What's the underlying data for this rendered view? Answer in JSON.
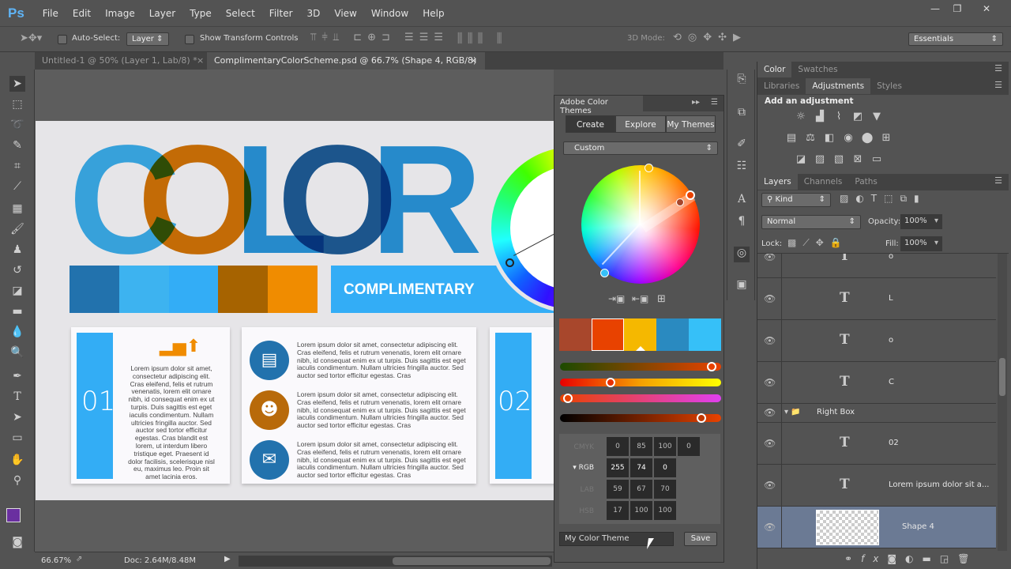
{
  "app": {
    "logo": "Ps",
    "menu": [
      "File",
      "Edit",
      "Image",
      "Layer",
      "Type",
      "Select",
      "Filter",
      "3D",
      "View",
      "Window",
      "Help"
    ],
    "window_controls": [
      "—",
      "❐",
      "✕"
    ]
  },
  "options": {
    "auto_select": "Auto-Select:",
    "layer_select": "Layer",
    "show_transform": "Show Transform Controls",
    "mode_3d": "3D Mode:",
    "workspace": "Essentials"
  },
  "tabs": [
    {
      "label": "Untitled-1 @ 50% (Layer 1, Lab/8) *",
      "close": "×"
    },
    {
      "label": "ComplimentaryColorScheme.psd @ 66.7% (Shape 4, RGB/8)",
      "close": "×"
    }
  ],
  "canvas": {
    "letters": [
      "C",
      "O",
      "L",
      "O",
      "R"
    ],
    "swatches": [
      "#2272ad",
      "#3db3f0",
      "#33adf6",
      "#a66300",
      "#f08c00"
    ],
    "banner": "COMPLIMENTARY",
    "card1": {
      "number": "01",
      "text": "Lorem ipsum dolor sit amet, consectetur adipiscing elit. Cras eleifend, felis et rutrum venenatis, lorem elit ornare nibh, id consequat enim ex ut turpis. Duis sagittis est eget iaculis condimentum. Nullam ultricies fringilla auctor. Sed auctor sed tortor efficitur egestas. Cras blandit est lorem, ut interdum libero tristique eget. Praesent id dolor facilisis, scelerisque nisl eu, maximus leo. Proin sit amet lacinia eros."
    },
    "card2": {
      "items": [
        {
          "icon": "browser-window-icon",
          "color": "#2272ad",
          "text": "Lorem ipsum dolor sit amet, consectetur adipiscing elit. Cras eleifend, felis et rutrum venenatis, lorem elit ornare nibh, id consequat enim ex ut turpis. Duis sagittis est eget iaculis condimentum. Nullam ultricies fringilla auctor. Sed auctor sed tortor efficitur egestas. Cras"
        },
        {
          "icon": "user-star-icon",
          "color": "#b86a0a",
          "text": "Lorem ipsum dolor sit amet, consectetur adipiscing elit. Cras eleifend, felis et rutrum venenatis, lorem elit ornare nibh, id consequat enim ex ut turpis. Duis sagittis est eget iaculis condimentum. Nullam ultricies fringilla auctor. Sed auctor sed tortor efficitur egestas. Cras"
        },
        {
          "icon": "envelope-icon",
          "color": "#2272ad",
          "text": "Lorem ipsum dolor sit amet, consectetur adipiscing elit. Cras eleifend, felis et rutrum venenatis, lorem elit ornare nibh, id consequat enim ex ut turpis. Duis sagittis est eget iaculis condimentum. Nullam ultricies fringilla auctor. Sed auctor sed tortor efficitur egestas. Cras"
        }
      ]
    },
    "card3": {
      "number": "02"
    }
  },
  "status": {
    "zoom": "66.67%",
    "doc": "Doc: 2.64M/8.48M"
  },
  "color_themes": {
    "title": "Adobe Color Themes",
    "tabs": [
      "Create",
      "Explore",
      "My Themes"
    ],
    "rule": "Custom",
    "theme": [
      "#a8472c",
      "#e84200",
      "#f5b800",
      "#2a8ac0",
      "#36c0f8"
    ],
    "selected_index": 1,
    "sliders": [
      0.97,
      0.3,
      0.02,
      0.9
    ],
    "values": {
      "cmyk_label": "CMYK",
      "cmyk": [
        "0",
        "85",
        "100",
        "0"
      ],
      "rgb_label": "RGB",
      "rgb": [
        "255",
        "74",
        "0"
      ],
      "lab_label": "LAB",
      "lab": [
        "59",
        "67",
        "70"
      ],
      "hsb_label": "HSB",
      "hsb": [
        "17",
        "100",
        "100"
      ]
    },
    "name_value": "My Color Theme",
    "save": "Save"
  },
  "panels": {
    "color_tabs": [
      "Color",
      "Swatches"
    ],
    "adj_tabs": [
      "Libraries",
      "Adjustments",
      "Styles"
    ],
    "adj_heading": "Add an adjustment",
    "layer_tabs": [
      "Layers",
      "Channels",
      "Paths"
    ],
    "kind": "Kind",
    "blend": "Normal",
    "opacity_label": "Opacity:",
    "opacity": "100%",
    "lock_label": "Lock:",
    "fill_label": "Fill:",
    "fill": "100%",
    "layers": [
      {
        "name": "o",
        "type": "text"
      },
      {
        "name": "L",
        "type": "text"
      },
      {
        "name": "o",
        "type": "text"
      },
      {
        "name": "C",
        "type": "text"
      },
      {
        "name": "Right Box",
        "type": "group"
      },
      {
        "name": "02",
        "type": "text"
      },
      {
        "name": "Lorem ipsum dolor sit a...",
        "type": "text"
      },
      {
        "name": "Shape 4",
        "type": "shape",
        "selected": true
      }
    ]
  }
}
